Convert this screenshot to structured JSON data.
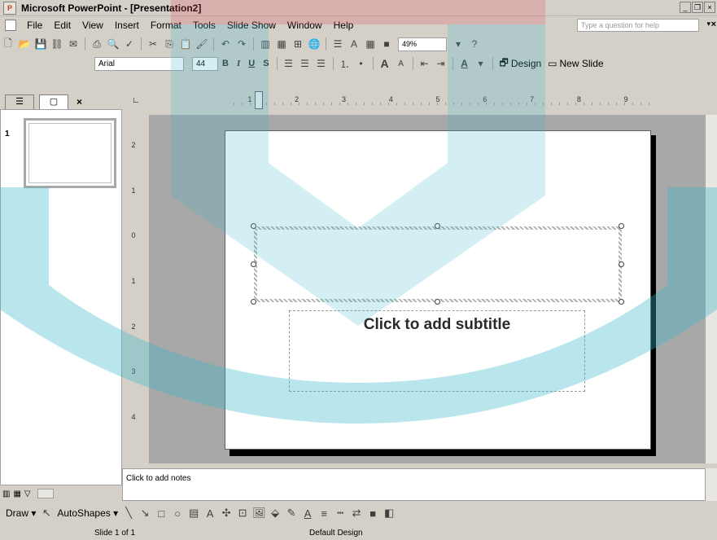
{
  "window": {
    "title": "Microsoft PowerPoint - [Presentation2]"
  },
  "menu": {
    "items": [
      "File",
      "Edit",
      "View",
      "Insert",
      "Format",
      "Tools",
      "Slide Show",
      "Window",
      "Help"
    ],
    "help_placeholder": "Type a question for help"
  },
  "standard_toolbar": {
    "zoom": "49%"
  },
  "formatting_toolbar": {
    "font": "Arial",
    "size": "44",
    "bold": "B",
    "italic": "I",
    "underline": "U",
    "shadow": "S",
    "design_label": "Design",
    "new_slide_label": "New Slide"
  },
  "pane": {
    "slide_number": "1"
  },
  "ruler": {
    "h_marks": [
      "1",
      "2",
      "3",
      "4",
      "5",
      "6",
      "7",
      "8",
      "9"
    ],
    "v_marks": [
      "2",
      "1",
      "0",
      "1",
      "2",
      "3",
      "4"
    ]
  },
  "slide": {
    "subtitle_placeholder": "Click to add subtitle"
  },
  "notes": {
    "placeholder": "Click to add notes"
  },
  "drawing_toolbar": {
    "draw_label": "Draw",
    "autoshapes_label": "AutoShapes"
  },
  "status": {
    "slide": "Slide 1 of 1",
    "design": "Default Design"
  }
}
